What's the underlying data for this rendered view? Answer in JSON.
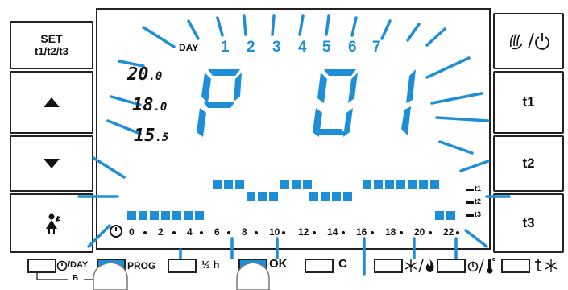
{
  "left_buttons": {
    "set_line1": "SET",
    "set_line2": "t1/t2/t3",
    "up_icon": "triangle-up-icon",
    "down_icon": "triangle-down-icon",
    "person_icon": "person-with-plant-icon"
  },
  "right_buttons": {
    "mode_icon": "hand-power-icon",
    "t1": "t1",
    "t2": "t2",
    "t3": "t3"
  },
  "display": {
    "day_label": "DAY",
    "days": [
      "1",
      "2",
      "3",
      "4",
      "5",
      "6",
      "7"
    ],
    "program": "P01",
    "temps": [
      {
        "main": "20",
        "dec": ".0"
      },
      {
        "main": "18",
        "dec": ".0"
      },
      {
        "main": "15",
        "dec": ".5"
      }
    ],
    "timeline": [
      "0",
      "2",
      "4",
      "6",
      "8",
      "10",
      "12",
      "14",
      "16",
      "18",
      "20",
      "22"
    ],
    "level_labels": [
      "t1",
      "t2",
      "t3"
    ],
    "accent_color": "#1e8fd6"
  },
  "bottom_bar": {
    "day_label": "/DAY",
    "prog_label": "PROG",
    "half_h_label": "½ h",
    "ok_label": "OK",
    "c_label": "C",
    "b_label": "B"
  }
}
